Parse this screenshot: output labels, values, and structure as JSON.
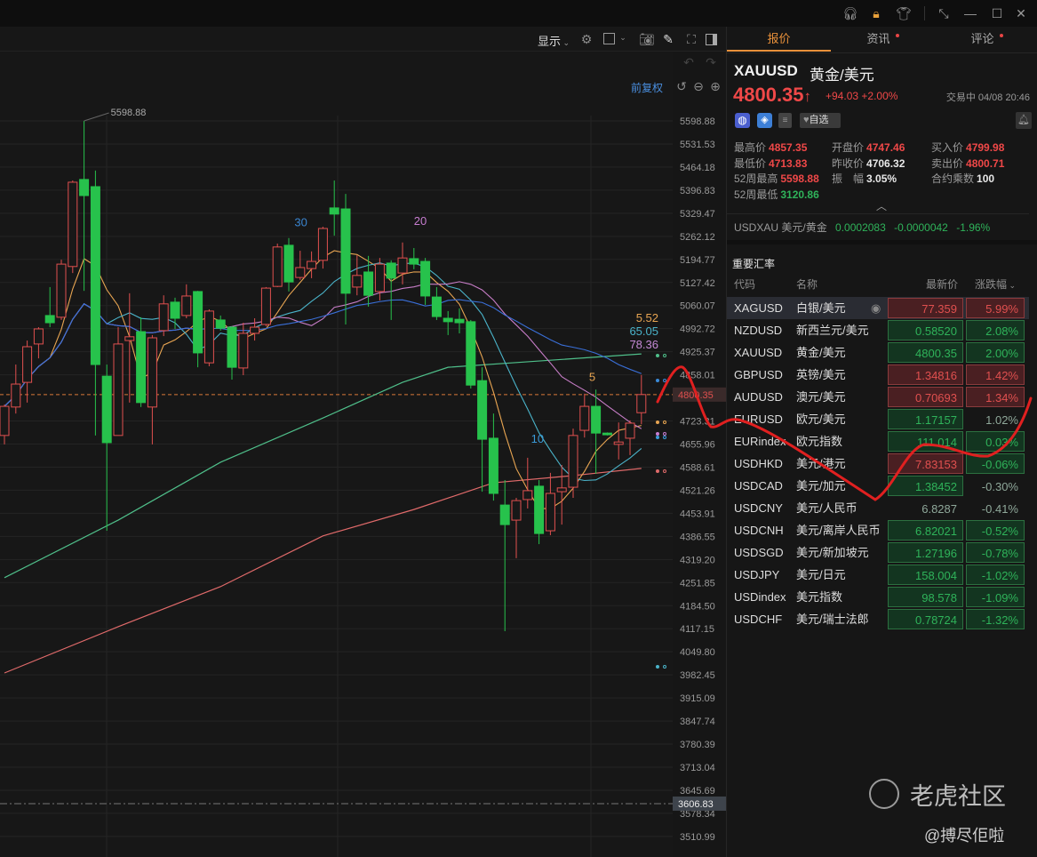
{
  "window": {
    "icons": [
      "headset-icon",
      "lock-icon",
      "shirt-icon",
      "compress-icon",
      "minimize-icon",
      "maximize-icon",
      "close-icon"
    ]
  },
  "toolbar": {
    "display_label": "显示",
    "fq_label": "前复权"
  },
  "chart_data": {
    "type": "candlestick",
    "symbol": "XAUUSD",
    "ylim": [
      3490,
      5610
    ],
    "y_ticks": [
      "5598.88",
      "5531.53",
      "5464.18",
      "5396.83",
      "5329.47",
      "5262.12",
      "5194.77",
      "5127.42",
      "5060.07",
      "4992.72",
      "4925.37",
      "4858.01",
      "4723.31",
      "4655.96",
      "4588.61",
      "4521.26",
      "4453.91",
      "4386.55",
      "4319.20",
      "4251.85",
      "4184.50",
      "4117.15",
      "4049.80",
      "3982.45",
      "3915.09",
      "3847.74",
      "3780.39",
      "3713.04",
      "3645.69",
      "3578.34",
      "3510.99"
    ],
    "current_price_tag": "4800.35",
    "current_price": 4800.35,
    "ref_line_tag": "3606.83",
    "ref_line": 3606.83,
    "high_annotation": "5598.88",
    "ma_labels": [
      {
        "text": "30",
        "color": "#3a85d0",
        "idx": 25.5,
        "price": 5292
      },
      {
        "text": "20",
        "color": "#c77dd0",
        "idx": 36,
        "price": 5296
      },
      {
        "text": "10",
        "color": "#3a9ad8",
        "idx": 46.3,
        "price": 4660
      },
      {
        "text": "5",
        "color": "#e8a552",
        "idx": 51.4,
        "price": 4840
      }
    ],
    "legend_values": [
      {
        "text": "5.52",
        "color": "#e8a552"
      },
      {
        "text": "65.05",
        "color": "#4ab3c9"
      },
      {
        "text": "78.36",
        "color": "#c58ad6"
      }
    ],
    "candles_ohlc": [
      [
        4681,
        4771,
        4655,
        4766
      ],
      [
        4764,
        4888,
        4745,
        4831
      ],
      [
        4836,
        4958,
        4777,
        4940
      ],
      [
        4948,
        4997,
        4906,
        4992
      ],
      [
        5031,
        5114,
        4997,
        5010
      ],
      [
        5026,
        5194,
        5018,
        5181
      ],
      [
        5174,
        5425,
        5155,
        5420
      ],
      [
        5428,
        5598.88,
        5103,
        5381
      ],
      [
        5407,
        5454,
        4681,
        4888
      ],
      [
        4854,
        4888,
        4403,
        4660
      ],
      [
        4681,
        4997,
        4681,
        4948
      ],
      [
        4958,
        5096,
        4777,
        4969
      ],
      [
        4984,
        5026,
        4764,
        4777
      ],
      [
        4764,
        4974,
        4655,
        4966
      ],
      [
        4987,
        5090,
        4971,
        5065
      ],
      [
        5070,
        5083,
        4992,
        5023
      ],
      [
        5031,
        5122,
        5023,
        5088
      ],
      [
        5101,
        5103,
        4880,
        4922
      ],
      [
        4893,
        5049,
        4883,
        5044
      ],
      [
        5018,
        5031,
        4987,
        4994
      ],
      [
        4997,
        5000,
        4844,
        4880
      ],
      [
        4878,
        5010,
        4857,
        4979
      ],
      [
        4979,
        5023,
        4958,
        4997
      ],
      [
        5005,
        5114,
        5000,
        5111
      ],
      [
        5116,
        5241,
        5114,
        5231
      ],
      [
        5236,
        5257,
        5101,
        5129
      ],
      [
        5142,
        5220,
        5135,
        5171
      ],
      [
        5168,
        5218,
        5140,
        5189
      ],
      [
        5192,
        5290,
        5168,
        5285
      ],
      [
        5345,
        5425,
        5264,
        5327
      ],
      [
        5342,
        5386,
        5005,
        5096
      ],
      [
        5114,
        5207,
        5090,
        5148
      ],
      [
        5158,
        5205,
        5057,
        5090
      ],
      [
        5101,
        5199,
        5075,
        5181
      ],
      [
        5184,
        5192,
        5018,
        5140
      ],
      [
        5155,
        5244,
        5122,
        5199
      ],
      [
        5197,
        5228,
        5166,
        5181
      ],
      [
        5189,
        5199,
        5062,
        5088
      ],
      [
        5085,
        5114,
        5018,
        5028
      ],
      [
        5023,
        5044,
        4974,
        5013
      ],
      [
        5020,
        5052,
        4979,
        5010
      ],
      [
        5013,
        5018,
        4818,
        4828
      ],
      [
        4841,
        4880,
        4517,
        4670
      ],
      [
        4673,
        4745,
        4491,
        4512
      ],
      [
        4478,
        4551,
        4110,
        4421
      ],
      [
        4434,
        4499,
        4323,
        4491
      ],
      [
        4494,
        4616,
        4468,
        4520
      ],
      [
        4533,
        4551,
        4364,
        4395
      ],
      [
        4403,
        4572,
        4390,
        4512
      ],
      [
        4517,
        4595,
        4421,
        4528
      ],
      [
        4530,
        4701,
        4499,
        4681
      ],
      [
        4696,
        4803,
        4675,
        4766
      ],
      [
        4766,
        4815,
        4569,
        4688
      ],
      [
        4688,
        4690,
        4681,
        4683
      ],
      [
        4655,
        4719,
        4611,
        4662
      ],
      [
        4673,
        4725,
        4624,
        4717
      ],
      [
        4747.46,
        4857.35,
        4713.83,
        4800.35
      ]
    ],
    "computed_ma": [
      {
        "period": 5,
        "color": "#e8a552"
      },
      {
        "period": 10,
        "color": "#4ab3c9"
      },
      {
        "period": 20,
        "color": "#c77dc7"
      },
      {
        "period": 30,
        "color": "#3a6fd8"
      }
    ],
    "long_ma": [
      {
        "name": "ma60",
        "color": "#4fbf8a",
        "points": [
          [
            0,
            4266
          ],
          [
            10,
            4434
          ],
          [
            19,
            4603
          ],
          [
            28,
            4732
          ],
          [
            35,
            4836
          ],
          [
            39,
            4880
          ],
          [
            46,
            4896
          ],
          [
            56,
            4919
          ]
        ]
      },
      {
        "name": "ma120",
        "color": "#e06a6a",
        "points": [
          [
            0,
            3988
          ],
          [
            10,
            4123
          ],
          [
            19,
            4240
          ],
          [
            28,
            4388
          ],
          [
            36,
            4465
          ],
          [
            43,
            4543
          ],
          [
            50,
            4564
          ],
          [
            56,
            4585
          ]
        ]
      }
    ],
    "colors": {
      "up": "#e0504f",
      "down": "#27c24c",
      "grid": "#242424"
    }
  },
  "panel": {
    "tabs": [
      {
        "label": "报价",
        "active": true
      },
      {
        "label": "资讯",
        "dot": true
      },
      {
        "label": "评论",
        "dot": true
      }
    ],
    "symbol": "XAUUSD",
    "name": "黄金/美元",
    "price": "4800.35",
    "arrow": "↑",
    "change": "+94.03",
    "change_pct": "+2.00%",
    "status": "交易中 04/08 20:46",
    "watch_label": "自选",
    "stats": [
      [
        {
          "label": "最高价",
          "value": "4857.35",
          "cls": "red"
        },
        {
          "label": "开盘价",
          "value": "4747.46",
          "cls": "red"
        },
        {
          "label": "买入价",
          "value": "4799.98",
          "cls": "red"
        }
      ],
      [
        {
          "label": "最低价",
          "value": "4713.83",
          "cls": "red"
        },
        {
          "label": "昨收价",
          "value": "4706.32",
          "cls": "white"
        },
        {
          "label": "卖出价",
          "value": "4800.71",
          "cls": "red"
        }
      ],
      [
        {
          "label": "52周最高",
          "value": "5598.88",
          "cls": "red"
        },
        {
          "label": "振　幅",
          "value": "3.05%",
          "cls": "white"
        },
        {
          "label": "合约乘数",
          "value": "100",
          "cls": "white"
        }
      ],
      [
        {
          "label": "52周最低",
          "value": "3120.86",
          "cls": "green"
        }
      ]
    ],
    "inverse": {
      "code": "USDXAU",
      "name": "美元/黄金",
      "price": "0.0002083",
      "change": "-0.0000042",
      "pct": "-1.96%"
    },
    "rates_title": "重要汇率",
    "headers": {
      "code": "代码",
      "name": "名称",
      "price": "最新价",
      "pct": "涨跌幅"
    },
    "rows": [
      {
        "code": "XAGUSD",
        "name": "白银/美元",
        "price": "77.359",
        "ps": "up",
        "pct": "5.99%",
        "cs": "up",
        "selected": true
      },
      {
        "code": "NZDUSD",
        "name": "新西兰元/美元",
        "price": "0.58520",
        "ps": "down",
        "pct": "2.08%",
        "cs": "down"
      },
      {
        "code": "XAUUSD",
        "name": "黄金/美元",
        "price": "4800.35",
        "ps": "down",
        "pct": "2.00%",
        "cs": "down"
      },
      {
        "code": "GBPUSD",
        "name": "英镑/美元",
        "price": "1.34816",
        "ps": "up",
        "pct": "1.42%",
        "cs": "up"
      },
      {
        "code": "AUDUSD",
        "name": "澳元/美元",
        "price": "0.70693",
        "ps": "up",
        "pct": "1.34%",
        "cs": "up"
      },
      {
        "code": "EURUSD",
        "name": "欧元/美元",
        "price": "1.17157",
        "ps": "down",
        "pct": "1.02%",
        "cs": "none"
      },
      {
        "code": "EURindex",
        "name": "欧元指数",
        "price": "111.014",
        "ps": "down",
        "pct": "0.03%",
        "cs": "down"
      },
      {
        "code": "USDHKD",
        "name": "美元/港元",
        "price": "7.83153",
        "ps": "up",
        "pct": "-0.06%",
        "cs": "down"
      },
      {
        "code": "USDCAD",
        "name": "美元/加元",
        "price": "1.38452",
        "ps": "down",
        "pct": "-0.30%",
        "cs": "none"
      },
      {
        "code": "USDCNY",
        "name": "美元/人民币",
        "price": "6.8287",
        "ps": "none",
        "pct": "-0.41%",
        "cs": "none"
      },
      {
        "code": "USDCNH",
        "name": "美元/离岸人民币",
        "price": "6.82021",
        "ps": "down",
        "pct": "-0.52%",
        "cs": "down"
      },
      {
        "code": "USDSGD",
        "name": "美元/新加坡元",
        "price": "1.27196",
        "ps": "down",
        "pct": "-0.78%",
        "cs": "down"
      },
      {
        "code": "USDJPY",
        "name": "美元/日元",
        "price": "158.004",
        "ps": "down",
        "pct": "-1.02%",
        "cs": "down"
      },
      {
        "code": "USDindex",
        "name": "美元指数",
        "price": "98.578",
        "ps": "down",
        "pct": "-1.09%",
        "cs": "down"
      },
      {
        "code": "USDCHF",
        "name": "美元/瑞士法郎",
        "price": "0.78724",
        "ps": "down",
        "pct": "-1.32%",
        "cs": "down"
      }
    ]
  },
  "watermark": {
    "brand": "老虎社区",
    "author": "@搏尽佢啦"
  }
}
